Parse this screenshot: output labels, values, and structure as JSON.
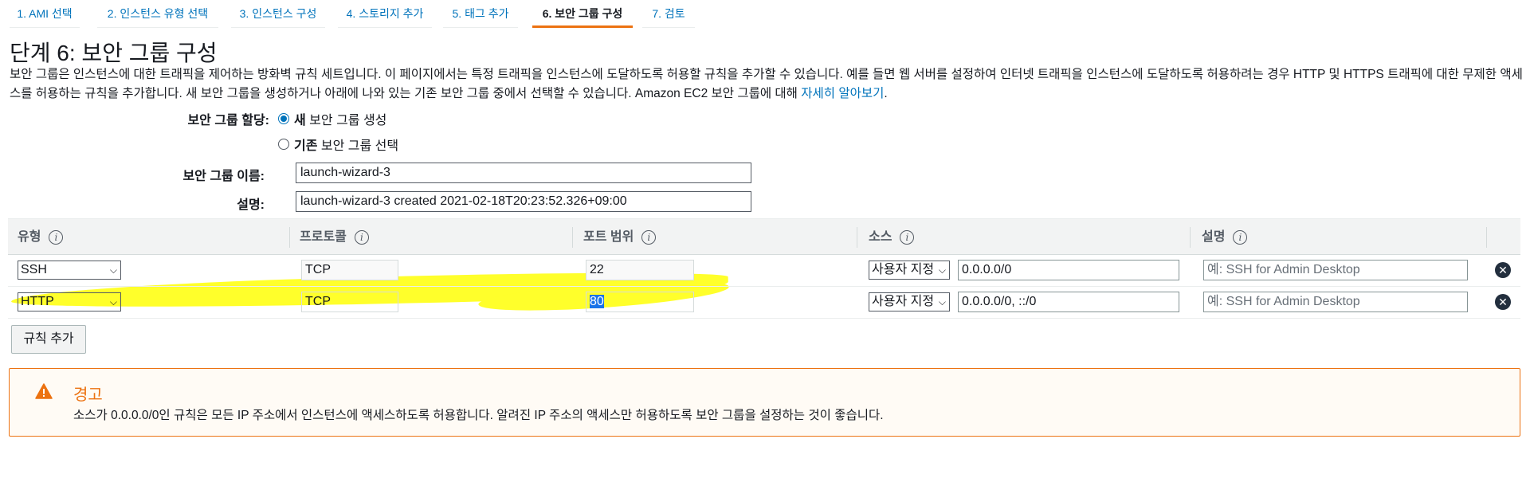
{
  "tabs": [
    {
      "label": "1. AMI 선택"
    },
    {
      "label": "2. 인스턴스 유형 선택"
    },
    {
      "label": "3. 인스턴스 구성"
    },
    {
      "label": "4. 스토리지 추가"
    },
    {
      "label": "5. 태그 추가"
    },
    {
      "label": "6. 보안 그룹 구성"
    },
    {
      "label": "7. 검토"
    }
  ],
  "page": {
    "title": "단계 6: 보안 그룹 구성",
    "intro": "보안 그룹은 인스턴스에 대한 트래픽을 제어하는 방화벽 규칙 세트입니다. 이 페이지에서는 특정 트래픽을 인스턴스에 도달하도록 허용할 규칙을 추가할 수 있습니다. 예를 들면 웹 서버를 설정하여 인터넷 트래픽을 인스턴스에 도달하도록 허용하려는 경우 HTTP 및 HTTPS 트래픽에 대한 무제한 액세스를 허용하는 규칙을 추가합니다. 새 보안 그룹을 생성하거나 아래에 나와 있는 기존 보안 그룹 중에서 선택할 수 있습니다. Amazon EC2 보안 그룹에 대해 ",
    "learn_more": "자세히 알아보기",
    "intro_end": "."
  },
  "form": {
    "assign_label": "보안 그룹 할당:",
    "option_new_bold": "새",
    "option_new_rest": " 보안 그룹 생성",
    "option_existing_bold": "기존",
    "option_existing_rest": " 보안 그룹 선택",
    "name_label": "보안 그룹 이름:",
    "name_value": "launch-wizard-3",
    "desc_label": "설명:",
    "desc_value": "launch-wizard-3 created 2021-02-18T20:23:52.326+09:00"
  },
  "table": {
    "headers": [
      "유형",
      "프로토콜",
      "포트 범위",
      "소스",
      "설명"
    ],
    "info_icon": "i",
    "rows": [
      {
        "type": "SSH",
        "protocol": "TCP",
        "port": "22",
        "source_type": "사용자 지정",
        "source": "0.0.0.0/0",
        "desc_placeholder": "예: SSH for Admin Desktop"
      },
      {
        "type": "HTTP",
        "protocol": "TCP",
        "port": "80",
        "source_type": "사용자 지정",
        "source": "0.0.0.0/0, ::/0",
        "desc_placeholder": "예: SSH for Admin Desktop"
      }
    ],
    "remove_symbol": "✕"
  },
  "add_rule_label": "규칙 추가",
  "warning": {
    "title": "경고",
    "body": "소스가 0.0.0.0/0인 규칙은 모든 IP 주소에서 인스턴스에 액세스하도록 허용합니다. 알려진 IP 주소의 액세스만 허용하도록 보안 그룹을 설정하는 것이 좋습니다."
  },
  "colors": {
    "link": "#0073bb",
    "active_tab_underline": "#ec7211",
    "warning": "#ec7211",
    "highlight": "#ffff2b"
  }
}
